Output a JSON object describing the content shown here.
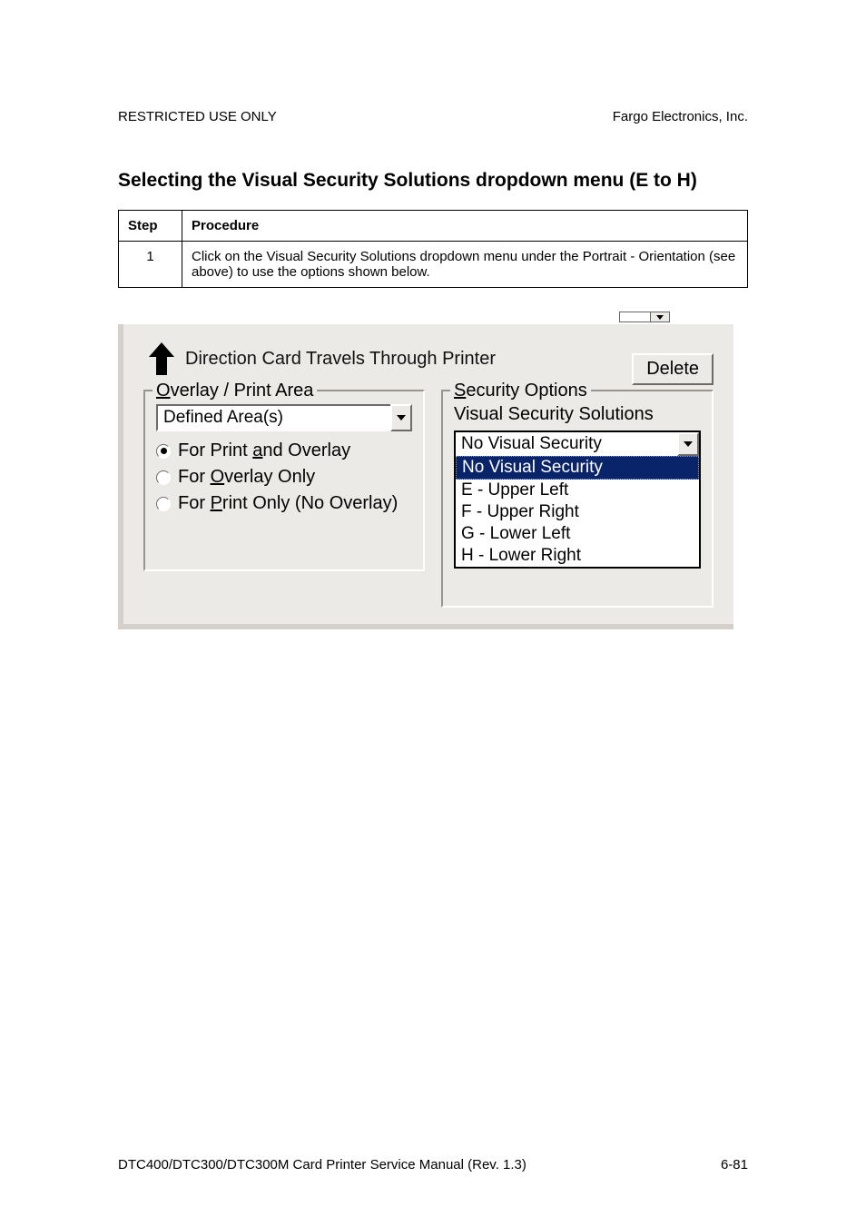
{
  "header": {
    "left": "RESTRICTED USE ONLY",
    "right": "Fargo Electronics, Inc."
  },
  "title": "Selecting the Visual Security Solutions dropdown menu (E to H)",
  "table": {
    "head_step": "Step",
    "head_proc": "Procedure",
    "row_step": "1",
    "row_proc": "Click on the Visual Security Solutions dropdown menu under the Portrait - Orientation (see above) to use the options shown below."
  },
  "dialog": {
    "direction_text": "Direction Card Travels Through Printer",
    "delete_label": "Delete",
    "overlay_legend_pre": "O",
    "overlay_legend_rest": "verlay / Print Area",
    "combo_value": "Defined Area(s)",
    "radio1_pre": "For Print ",
    "radio1_u": "a",
    "radio1_post": "nd Overlay",
    "radio2_pre": "For ",
    "radio2_u": "O",
    "radio2_post": "verlay Only",
    "radio3_pre": "For ",
    "radio3_u": "P",
    "radio3_post": "rint Only (No Overlay)",
    "security_legend_pre": "S",
    "security_legend_rest": "ecurity Options",
    "vss_label": "Visual Security Solutions",
    "dropdown_current": "No Visual Security",
    "dd_items": {
      "0": "No Visual Security",
      "1": "E - Upper Left",
      "2": "F - Upper Right",
      "3": "G - Lower Left",
      "4": "H - Lower Right"
    }
  },
  "footer": {
    "left": "DTC400/DTC300/DTC300M Card Printer Service Manual (Rev. 1.3)",
    "right": "6-81"
  }
}
